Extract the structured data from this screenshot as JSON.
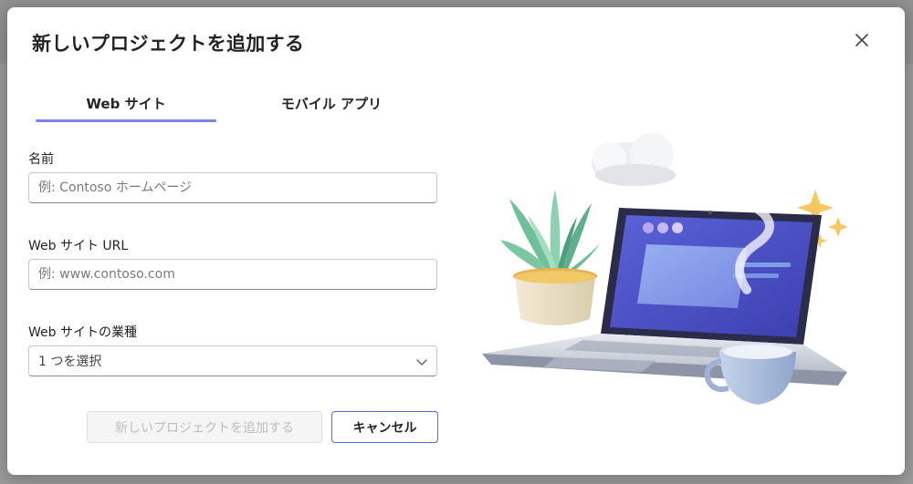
{
  "dialog": {
    "title": "新しいプロジェクトを追加する",
    "close_icon": "close-icon"
  },
  "tabs": [
    {
      "label": "Web サイト",
      "selected": true
    },
    {
      "label": "モバイル アプリ",
      "selected": false
    }
  ],
  "form": {
    "name": {
      "label": "名前",
      "placeholder": "例: Contoso ホームページ",
      "value": ""
    },
    "url": {
      "label": "Web サイト URL",
      "placeholder": "例: www.contoso.com",
      "value": ""
    },
    "industry": {
      "label": "Web サイトの業種",
      "selected": "1 つを選択",
      "chevron_icon": "chevron-down-icon"
    }
  },
  "buttons": {
    "add_project": "新しいプロジェクトを追加する",
    "cancel": "キャンセル"
  },
  "colors": {
    "accent": "#7b83eb",
    "cancel_border": "#4f6bed",
    "disabled_text": "#bdbdbd"
  },
  "illustration": {
    "icons": [
      "laptop-icon",
      "plant-icon",
      "coffee-cup-icon",
      "cloud-icon",
      "sparkle-icon"
    ]
  }
}
